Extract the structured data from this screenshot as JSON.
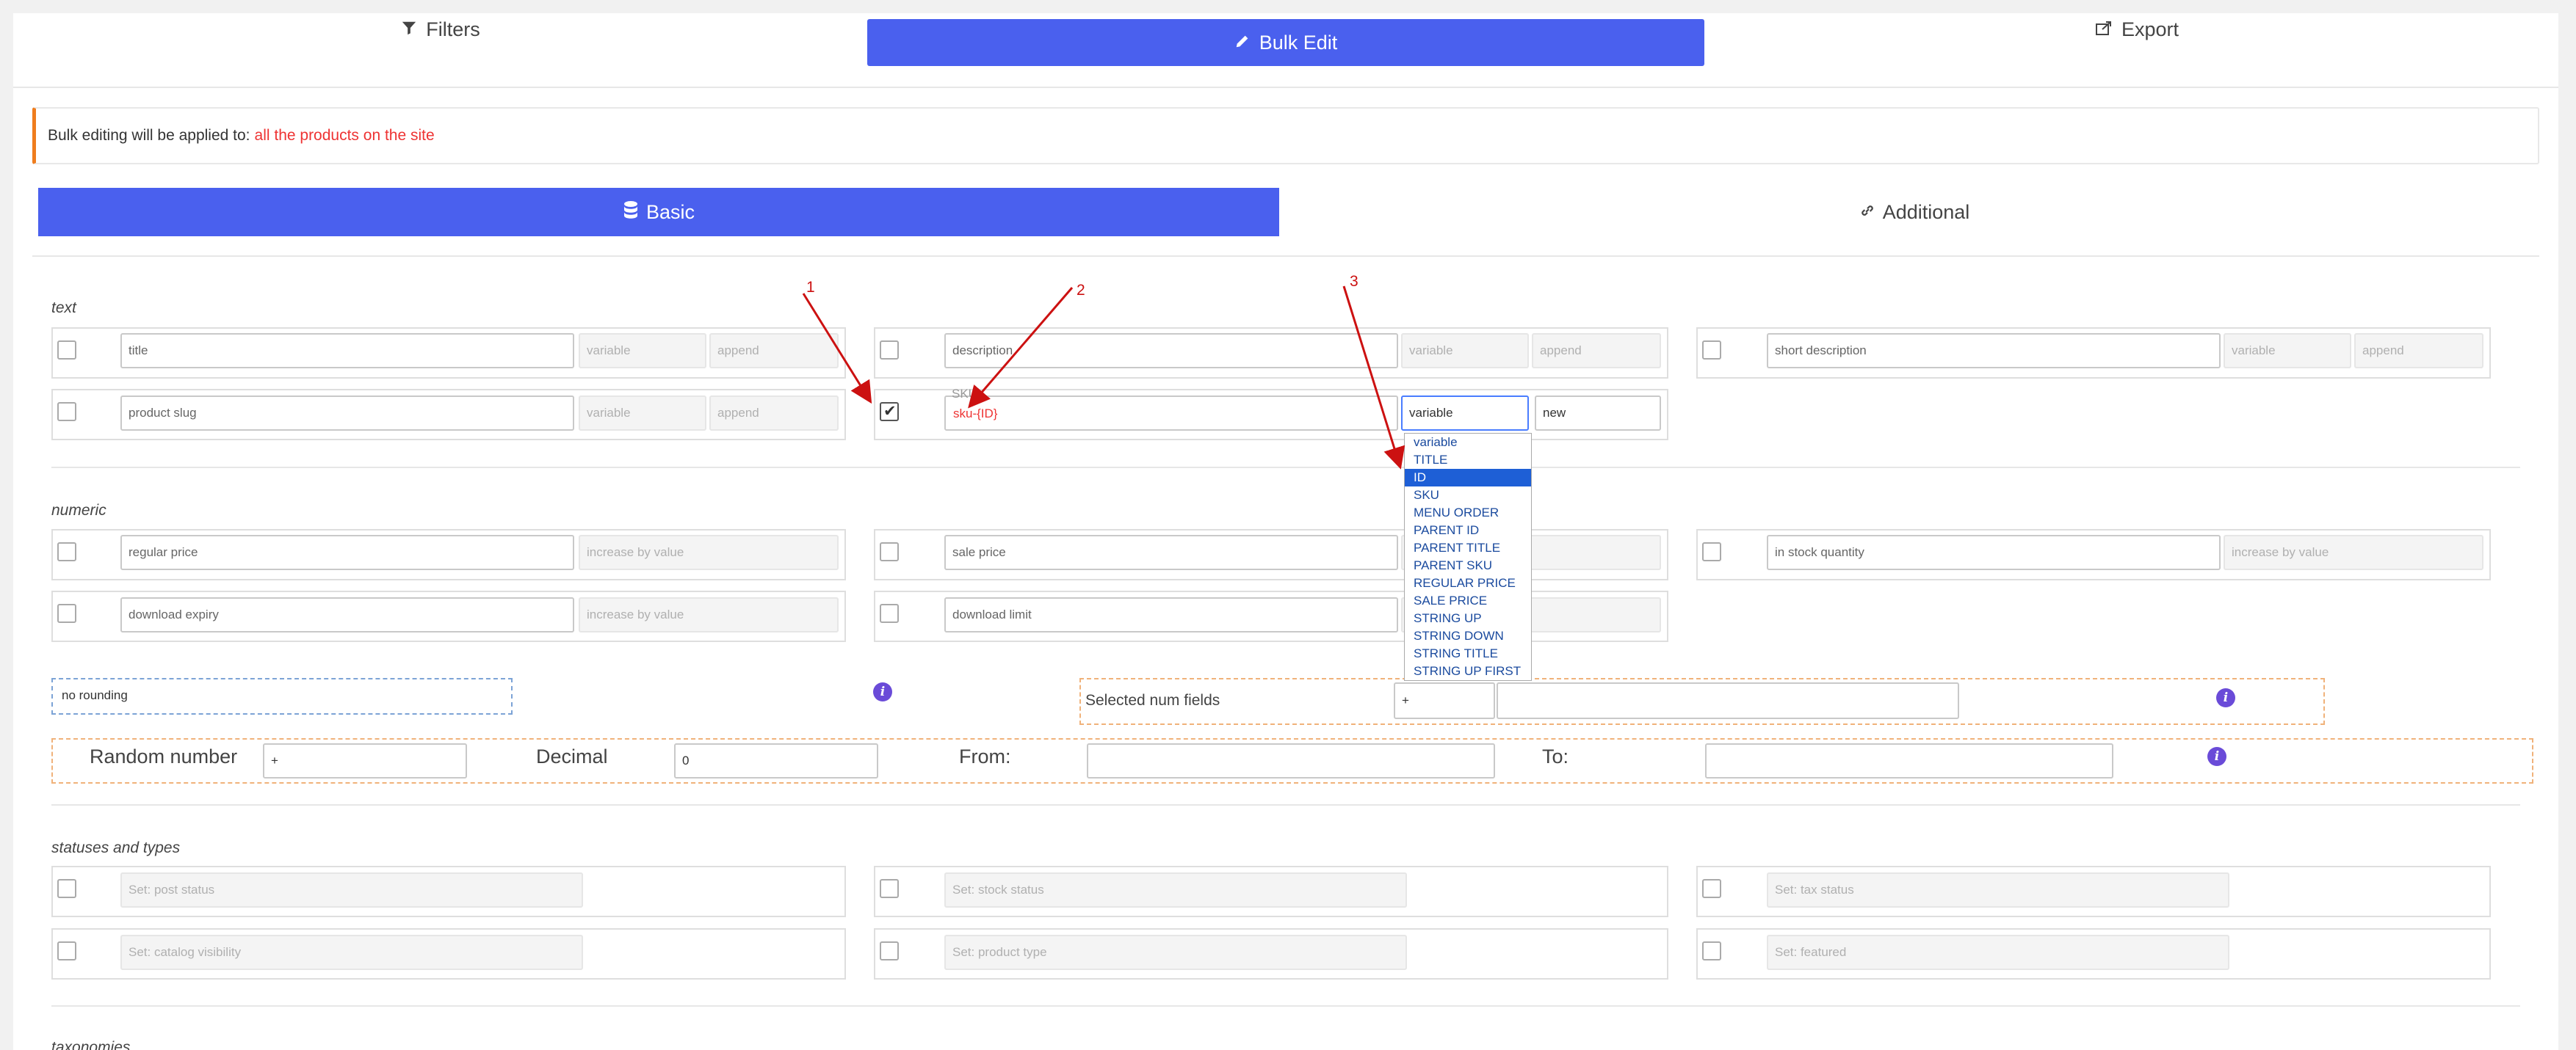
{
  "tabs": [
    {
      "label": "Filters",
      "icon": "filter-icon"
    },
    {
      "label": "Bulk Edit",
      "icon": "pencil-icon"
    },
    {
      "label": "Export",
      "icon": "export-icon"
    }
  ],
  "notice": {
    "prefix": "Bulk editing will be applied to:",
    "target": "all the products on the site"
  },
  "subtabs": [
    {
      "label": "Basic",
      "icon": "database-icon"
    },
    {
      "label": "Additional",
      "icon": "link-icon"
    }
  ],
  "sections": {
    "text": "text",
    "numeric": "numeric",
    "statuses": "statuses and types",
    "taxonomies": "taxonomies"
  },
  "text_fields": {
    "title": {
      "value": "title",
      "mode": "variable",
      "action": "append"
    },
    "description": {
      "value": "description",
      "mode": "variable",
      "action": "append"
    },
    "short_description": {
      "value": "short description",
      "mode": "variable",
      "action": "append"
    },
    "product_slug": {
      "value": "product slug",
      "mode": "variable",
      "action": "append"
    },
    "sku": {
      "label": "SKU",
      "value": "sku-{ID}",
      "mode": "variable",
      "action": "new"
    }
  },
  "numeric_fields": {
    "regular_price": {
      "value": "regular price",
      "mode": "increase by value"
    },
    "sale_price": {
      "value": "sale price"
    },
    "in_stock_quantity": {
      "value": "in stock quantity",
      "mode": "increase by value"
    },
    "download_expiry": {
      "value": "download expiry",
      "mode": "increase by value"
    },
    "download_limit": {
      "value": "download limit"
    }
  },
  "variable_dropdown": {
    "options": [
      "variable",
      "TITLE",
      "ID",
      "SKU",
      "MENU ORDER",
      "PARENT ID",
      "PARENT TITLE",
      "PARENT SKU",
      "REGULAR PRICE",
      "SALE PRICE",
      "STRING UP",
      "STRING DOWN",
      "STRING TITLE",
      "STRING UP FIRST"
    ],
    "selected": "ID"
  },
  "rounding": {
    "value": "no rounding"
  },
  "selected_num": {
    "label": "Selected num fields",
    "operator": "+",
    "value": ""
  },
  "random": {
    "label": "Random number",
    "operator": "+",
    "decimal_label": "Decimal",
    "decimal_value": "0",
    "from_label": "From:",
    "to_label": "To:",
    "from_value": "",
    "to_value": ""
  },
  "status_fields": {
    "post_status": "Set: post status",
    "stock_status": "Set: stock status",
    "tax_status": "Set: tax status",
    "catalog_visibility": "Set: catalog visibility",
    "product_type": "Set: product type",
    "featured": "Set: featured"
  },
  "annotations": [
    "1",
    "2",
    "3"
  ],
  "colors": {
    "accent": "#4a60ee",
    "annotation": "#cc1111",
    "notice_border": "#ef7d1e",
    "info": "#6a4bd8"
  }
}
